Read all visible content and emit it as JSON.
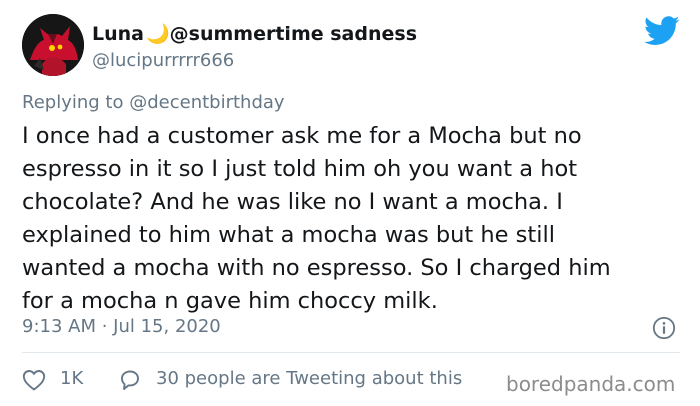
{
  "author": {
    "display_name": "Luna",
    "moon_glyph": "🌙",
    "name_suffix": "@summertime sadness",
    "handle": "@lucipurrrrr666",
    "avatar_icon": "demon-character-avatar-icon"
  },
  "brand": {
    "icon": "twitter-bird-icon",
    "color": "#1da1f2"
  },
  "reply_context": {
    "prefix": "Replying to",
    "mention": "@decentbirthday"
  },
  "tweet": {
    "lines": [
      "I once had a customer ask me for a Mocha but no",
      "espresso in it so I just told him oh you want a hot",
      "chocolate? And he was like no I want a mocha. I",
      "explained to him what a mocha was but he still",
      "wanted a mocha with no espresso. So I charged him",
      "for a mocha n gave him choccy milk."
    ],
    "timestamp": "9:13 AM · Jul 15, 2020"
  },
  "actions": {
    "like_count": "1K",
    "tweeting_about": "30 people are Tweeting about this",
    "like_icon": "heart-icon",
    "reply_icon": "comment-bubble-icon",
    "info_icon": "info-icon"
  },
  "watermark": "boredpanda.com",
  "colors": {
    "text": "#14171a",
    "muted": "#657786",
    "divider": "#e1e8ed"
  }
}
